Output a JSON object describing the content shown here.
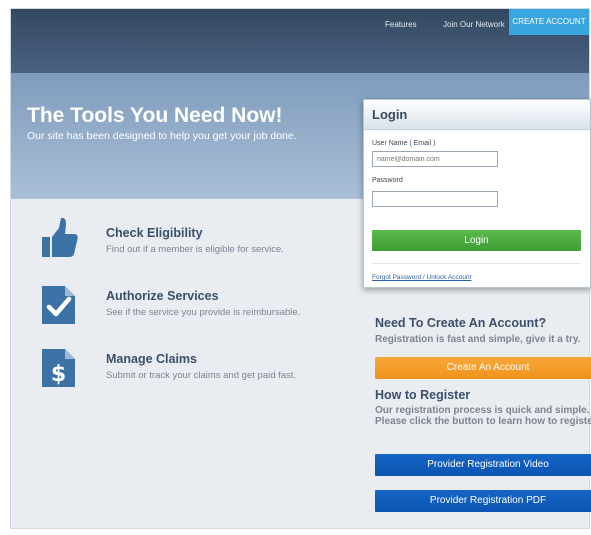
{
  "nav": {
    "features": "Features",
    "join": "Join Our Network",
    "create_account": "CREATE ACCOUNT"
  },
  "hero": {
    "title": "The Tools You Need Now!",
    "subtitle": "Our site has been designed to help you get your job done."
  },
  "features": [
    {
      "title": "Check Eligibility",
      "description": "Find out if a member is eligible for service.",
      "icon": "thumbs-up-icon"
    },
    {
      "title": "Authorize Services",
      "description": "See if the service you provide is reimbursable.",
      "icon": "checkmark-document-icon"
    },
    {
      "title": "Manage Claims",
      "description": "Submit or track your claims and get paid fast.",
      "icon": "dollar-document-icon"
    }
  ],
  "login": {
    "title": "Login",
    "username_label": "User Name ( Email )",
    "username_placeholder": "name@domain.com",
    "password_label": "Password",
    "button": "Login",
    "forgot": "Forgot Password / Unlock Account"
  },
  "create": {
    "heading": "Need To Create An Account?",
    "text": "Registration is fast and simple, give it a try.",
    "button": "Create An Account"
  },
  "register": {
    "heading": "How to Register",
    "text": "Our registration process is quick and simple. Please click the button to learn how to register.",
    "video_button": "Provider Registration Video",
    "pdf_button": "Provider Registration PDF"
  },
  "colors": {
    "accent_blue": "#3aa6df",
    "login_green": "#4aa93f",
    "create_orange": "#f39b22",
    "register_blue": "#0f5cbb",
    "icon_blue": "#3d72a6"
  }
}
